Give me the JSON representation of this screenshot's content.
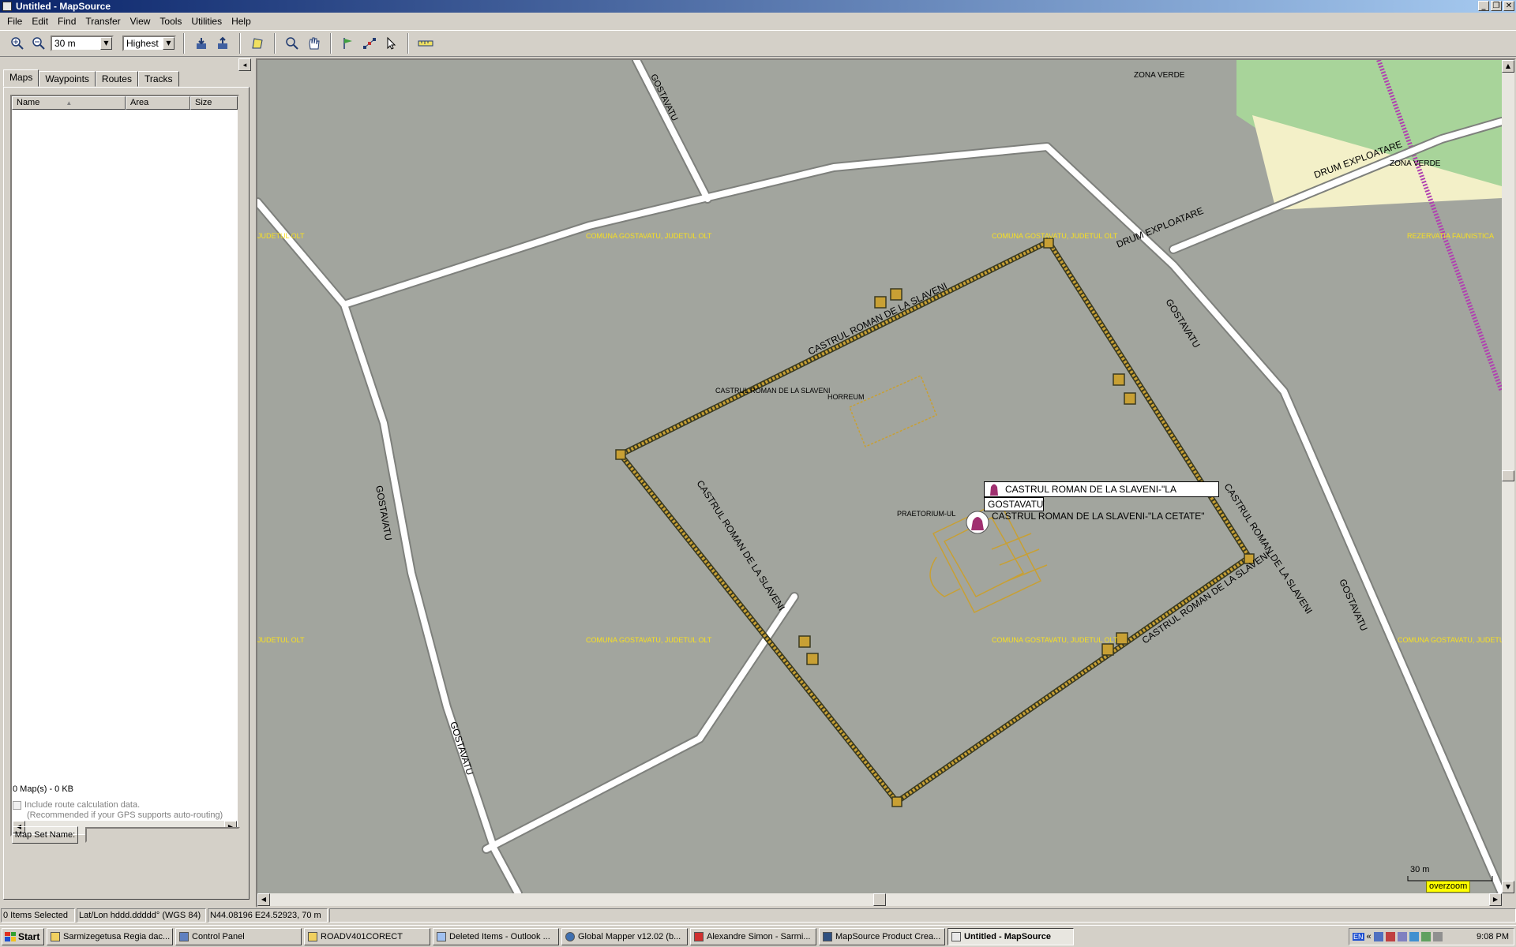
{
  "window": {
    "title": "Untitled - MapSource",
    "minimize": "_",
    "restore": "❐",
    "close": "✕"
  },
  "menu": [
    "File",
    "Edit",
    "Find",
    "Transfer",
    "View",
    "Tools",
    "Utilities",
    "Help"
  ],
  "toolbar": {
    "zoom_value": "30 m",
    "detail_value": "Highest",
    "icons": [
      "zoom-in-icon",
      "zoom-out-icon",
      "receive-from-device-icon",
      "send-to-device-icon",
      "map-select-icon",
      "zoom-tool-icon",
      "pan-hand-icon",
      "waypoint-flag-icon",
      "route-tool-icon",
      "selection-arrow-icon",
      "measure-ruler-icon"
    ]
  },
  "left_panel": {
    "collapse_glyph": "◂",
    "tabs": [
      "Maps",
      "Waypoints",
      "Routes",
      "Tracks"
    ],
    "active_tab": "Maps",
    "columns": [
      "Name",
      "Area",
      "Size"
    ],
    "map_count": "0 Map(s) - 0 KB",
    "include_route": "Include route calculation data.",
    "include_route_note": "(Recommended if your GPS supports auto-routing)",
    "map_set_button": "Map Set Name:"
  },
  "map": {
    "labels": {
      "zona_verde_1": "ZONA VERDE",
      "zona_verde_2": "ZONA VERDE",
      "drum_1": "DRUM EXPLOATARE",
      "drum_2": "DRUM EXPLOATARE",
      "gostavatu": "GOSTAVATU",
      "castrul_area": "CASTRUL ROMAN DE LA SLAVENI",
      "horreum": "HORREUM",
      "praetorium": "PRAETORIUM-UL",
      "wall": "CASTRUL ROMAN DE LA SLAVENI",
      "poi_label": "CASTRUL ROMAN DE LA SLAVENI-\"LA CETATE\"",
      "county": "COMUNA GOSTAVATU, JUDETUL OLT",
      "rezervatie": "REZERVATIA FAUNISTICA",
      "county_edge": "JUDETUL OLT"
    },
    "tooltip_main": "CASTRUL ROMAN DE LA SLAVENI-\"LA CETATE\"",
    "tooltip_sub": "GOSTAVATU",
    "scale": "30 m",
    "overzoom": "overzoom",
    "colors": {
      "background": "#a2a59e",
      "road": "#ffffff",
      "road_casing": "#7e807c",
      "fort": "#c8a034",
      "green": "#a8d49a",
      "cream": "#f3f0c8",
      "rail": "#b040b0",
      "county_text": "#f8e020"
    }
  },
  "status": {
    "selected": "0 Items Selected",
    "format": "Lat/Lon hddd.ddddd° (WGS 84)",
    "position": "N44.08196 E24.52923, 70 m"
  },
  "taskbar": {
    "start": "Start",
    "tasks": [
      "Sarmizegetusa Regia dac...",
      "Control Panel",
      "ROADV401CORECT",
      "Deleted Items - Outlook ...",
      "Global Mapper v12.02 (b...",
      "Alexandre Simon - Sarmi...",
      "MapSource Product Crea...",
      "Untitled - MapSource"
    ],
    "tray": {
      "language": "EN",
      "chevron": "«",
      "clock": "9:08 PM"
    }
  }
}
